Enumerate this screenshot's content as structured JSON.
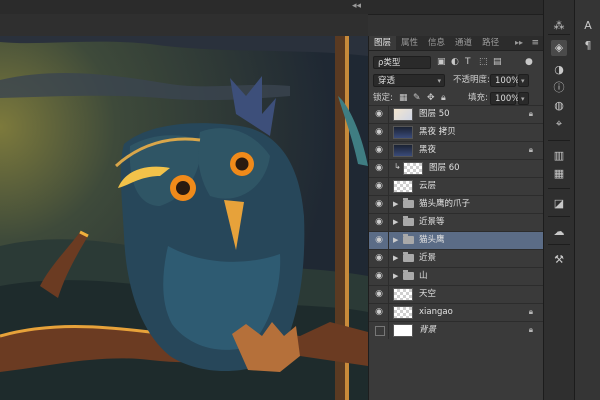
{
  "panel": {
    "tabs": [
      {
        "label": "图层",
        "active": true
      },
      {
        "label": "属性",
        "active": false
      },
      {
        "label": "信息",
        "active": false
      },
      {
        "label": "通道",
        "active": false
      },
      {
        "label": "路径",
        "active": false
      }
    ],
    "filter_kind": "ρ类型",
    "blend_mode": "穿透",
    "opacity_label": "不透明度:",
    "opacity_value": "100%",
    "lock_label": "锁定:",
    "fill_label": "填充:",
    "fill_value": "100%"
  },
  "layers": [
    {
      "name": "图层 50",
      "type": "pixel",
      "visible": true,
      "locked": true,
      "selected": false,
      "thumb": "light",
      "clipped": false
    },
    {
      "name": "黑夜 拷贝",
      "type": "pixel",
      "visible": true,
      "locked": false,
      "selected": false,
      "thumb": "dark",
      "clipped": false
    },
    {
      "name": "黑夜",
      "type": "pixel",
      "visible": true,
      "locked": true,
      "selected": false,
      "thumb": "dark",
      "clipped": false
    },
    {
      "name": "图层 60",
      "type": "pixel",
      "visible": true,
      "locked": false,
      "selected": false,
      "thumb": "checker",
      "clipped": true
    },
    {
      "name": "云层",
      "type": "pixel",
      "visible": true,
      "locked": false,
      "selected": false,
      "thumb": "checker",
      "clipped": false
    },
    {
      "name": "猫头鹰的爪子",
      "type": "group",
      "visible": true,
      "locked": false,
      "selected": false,
      "clipped": false
    },
    {
      "name": "近景等",
      "type": "group",
      "visible": true,
      "locked": false,
      "selected": false,
      "clipped": false
    },
    {
      "name": "猫头鹰",
      "type": "group",
      "visible": true,
      "locked": false,
      "selected": true,
      "clipped": false
    },
    {
      "name": "近景",
      "type": "group",
      "visible": true,
      "locked": false,
      "selected": false,
      "clipped": false
    },
    {
      "name": "山",
      "type": "group",
      "visible": true,
      "locked": false,
      "selected": false,
      "clipped": false
    },
    {
      "name": "天空",
      "type": "pixel",
      "visible": true,
      "locked": false,
      "selected": false,
      "thumb": "checker",
      "clipped": false
    },
    {
      "name": "xiangao",
      "type": "pixel",
      "visible": true,
      "locked": true,
      "selected": false,
      "thumb": "checker",
      "clipped": false
    },
    {
      "name": "背景",
      "type": "pixel",
      "visible": false,
      "locked": true,
      "selected": false,
      "thumb": "white",
      "clipped": false
    }
  ],
  "dock": {
    "icons": [
      "brush-presets-icon",
      "layers-icon",
      "adjustments-icon",
      "info-icon",
      "color-icon",
      "paths-icon",
      "histogram-icon",
      "swatches-icon",
      "navigator-icon",
      "creative-cloud-icon",
      "tool-presets-icon"
    ]
  },
  "dock2": {
    "icons": [
      "character-icon",
      "paragraph-icon"
    ],
    "character_glyph": "A",
    "paragraph_glyph": "¶"
  },
  "colors": {
    "panel_bg": "#3a3a3a",
    "selected_row": "#5b6c86",
    "canvas_sky": "#1c2530"
  }
}
